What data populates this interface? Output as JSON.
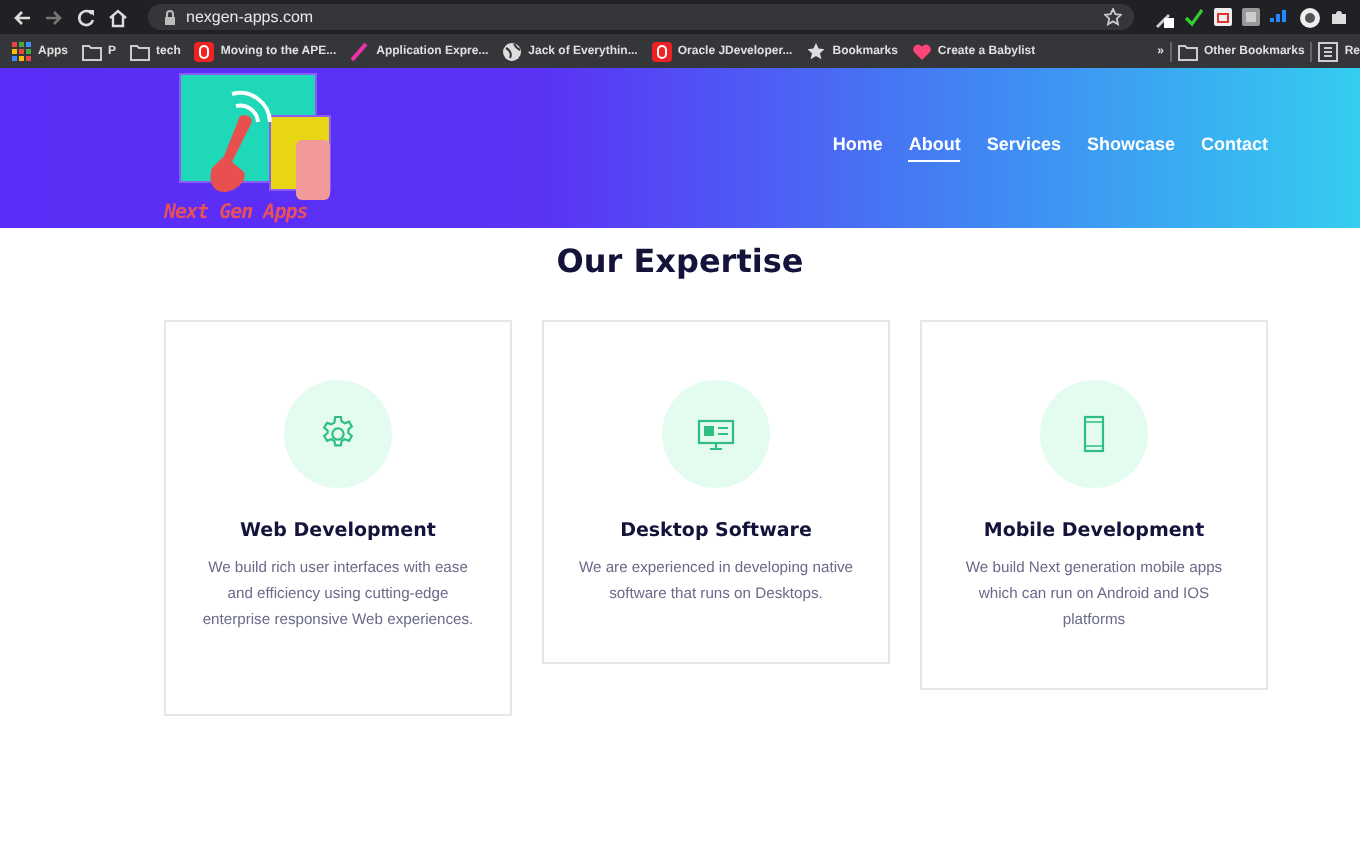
{
  "browser": {
    "url": "nexgen-apps.com"
  },
  "bookmarks": [
    {
      "label": "Apps",
      "kind": "apps"
    },
    {
      "label": "P",
      "kind": "folder"
    },
    {
      "label": "tech",
      "kind": "folder"
    },
    {
      "label": "Moving to the APE...",
      "kind": "red"
    },
    {
      "label": "Application Expre...",
      "kind": "feather"
    },
    {
      "label": "Jack of Everythin...",
      "kind": "globe"
    },
    {
      "label": "Oracle JDeveloper...",
      "kind": "red"
    },
    {
      "label": "Bookmarks",
      "kind": "star"
    },
    {
      "label": "Create a Babylist",
      "kind": "heart"
    }
  ],
  "more_bookmarks": "»",
  "other_bookmarks": [
    {
      "label": "Other Bookmarks",
      "kind": "folder"
    },
    {
      "label": "Re",
      "kind": "list"
    }
  ],
  "site": {
    "logo_text": "Next Gen Apps",
    "nav": [
      {
        "label": "Home",
        "selected": false
      },
      {
        "label": "About",
        "selected": true
      },
      {
        "label": "Services",
        "selected": false
      },
      {
        "label": "Showcase",
        "selected": false
      },
      {
        "label": "Contact",
        "selected": false
      }
    ],
    "heading": "Our Expertise",
    "cards": [
      {
        "kind": "gear",
        "title": "Web Development",
        "text": "We build rich user interfaces with ease and efficiency using cutting-edge enterprise responsive Web experiences."
      },
      {
        "kind": "monitor",
        "title": "Desktop Software",
        "text": "We are experienced in developing native software that runs on Desktops."
      },
      {
        "kind": "phone",
        "title": "Mobile Development",
        "text": "We build Next generation mobile apps which can run on Android and IOS platforms"
      }
    ]
  }
}
